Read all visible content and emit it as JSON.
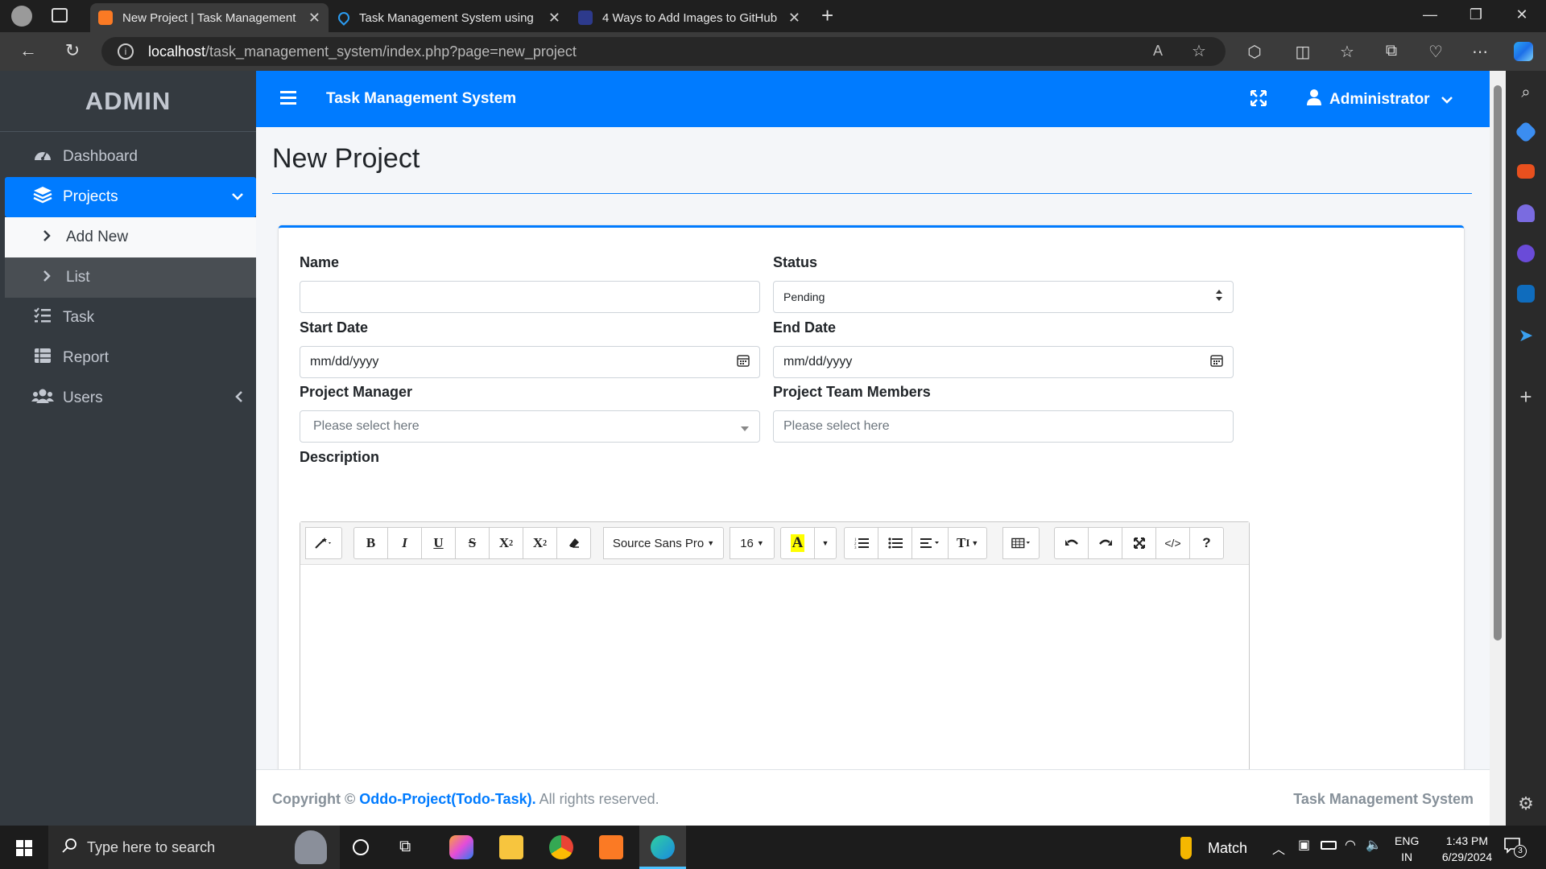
{
  "browser": {
    "tabs": [
      {
        "title": "New Project | Task Management",
        "active": true
      },
      {
        "title": "Task Management System using",
        "active": false
      },
      {
        "title": "4 Ways to Add Images to GitHub",
        "active": false
      }
    ],
    "url_host": "localhost",
    "url_path": "/task_management_system/index.php?page=new_project"
  },
  "sidebar": {
    "brand": "ADMIN",
    "items": [
      {
        "label": "Dashboard",
        "icon": "dashboard-icon"
      },
      {
        "label": "Projects",
        "icon": "layers-icon"
      },
      {
        "label": "Add New",
        "icon": "chevron-right-icon"
      },
      {
        "label": "List",
        "icon": "chevron-right-icon"
      },
      {
        "label": "Task",
        "icon": "tasks-icon"
      },
      {
        "label": "Report",
        "icon": "table-icon"
      },
      {
        "label": "Users",
        "icon": "users-icon"
      }
    ]
  },
  "topbar": {
    "title": "Task Management System",
    "user": "Administrator"
  },
  "page": {
    "title": "New Project"
  },
  "form": {
    "name_label": "Name",
    "name_value": "",
    "status_label": "Status",
    "status_value": "Pending",
    "start_label": "Start Date",
    "start_placeholder": "mm/dd/yyyy",
    "end_label": "End Date",
    "end_placeholder": "mm/dd/yyyy",
    "manager_label": "Project Manager",
    "manager_placeholder": "Please select here",
    "team_label": "Project Team Members",
    "team_placeholder": "Please select here",
    "description_label": "Description"
  },
  "editor": {
    "font_name": "Source Sans Pro",
    "font_size": "16"
  },
  "footer": {
    "copyright_prefix": "Copyright © ",
    "copyright_link": "Oddo-Project(Todo-Task).",
    "copyright_suffix": " All rights reserved.",
    "right": "Task Management System"
  },
  "taskbar": {
    "search_placeholder": "Type here to search",
    "weather": "Match",
    "lang_top": "ENG",
    "lang_bottom": "IN",
    "time": "1:43 PM",
    "date": "6/29/2024",
    "notif_count": "3"
  },
  "colors": {
    "primary": "#007bff",
    "sidebar_bg": "#343a40",
    "page_bg": "#f4f6f9"
  }
}
